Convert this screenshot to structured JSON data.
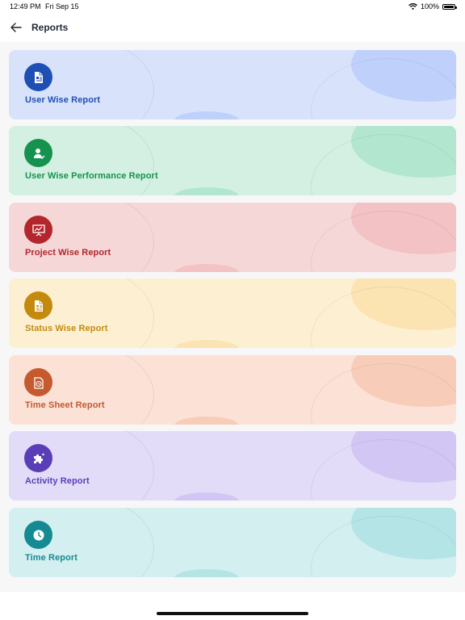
{
  "status": {
    "time": "12:49 PM",
    "date": "Fri Sep 15",
    "battery": "100%"
  },
  "header": {
    "title": "Reports"
  },
  "reports": [
    {
      "label": "User Wise Report",
      "bg": "#d8e3fb",
      "accent": "#1f4fb5",
      "blob": "#bfd0fa",
      "icon": "report-document-icon"
    },
    {
      "label": "User Wise Performance Report",
      "bg": "#d3f0e2",
      "accent": "#16924f",
      "blob": "#b3e6ce",
      "icon": "user-check-icon"
    },
    {
      "label": "Project Wise Report",
      "bg": "#f6d7d7",
      "accent": "#b3262c",
      "blob": "#f2c2c4",
      "icon": "presentation-chart-icon"
    },
    {
      "label": "Status Wise Report",
      "bg": "#fdf0d2",
      "accent": "#c48a0e",
      "blob": "#fbe3b2",
      "icon": "status-document-icon"
    },
    {
      "label": "Time Sheet Report",
      "bg": "#fbe1d6",
      "accent": "#c45a2e",
      "blob": "#f7cdb9",
      "icon": "timesheet-icon"
    },
    {
      "label": "Activity Report",
      "bg": "#e2dcf8",
      "accent": "#5a3eb8",
      "blob": "#d1c6f4",
      "icon": "activity-puzzle-icon"
    },
    {
      "label": "Time Report",
      "bg": "#d4eff0",
      "accent": "#168a93",
      "blob": "#b5e4e7",
      "icon": "clock-icon"
    }
  ]
}
